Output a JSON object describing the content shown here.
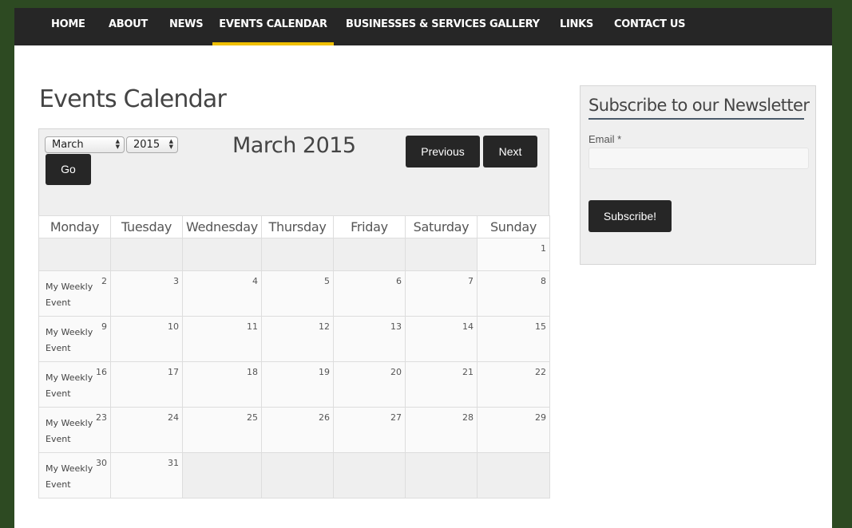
{
  "nav": {
    "items": [
      {
        "label": "HOME"
      },
      {
        "label": "ABOUT"
      },
      {
        "label": "NEWS"
      },
      {
        "label": "EVENTS CALENDAR",
        "active": true
      },
      {
        "label": "BUSINESSES & SERVICES"
      },
      {
        "label": "GALLERY"
      },
      {
        "label": "LINKS"
      },
      {
        "label": "CONTACT US"
      }
    ]
  },
  "page": {
    "title": "Events Calendar"
  },
  "calendar": {
    "month_select": "March",
    "year_select": "2015",
    "go_label": "Go",
    "title": "March 2015",
    "prev_label": "Previous",
    "next_label": "Next",
    "weekdays": [
      "Monday",
      "Tuesday",
      "Wednesday",
      "Thursday",
      "Friday",
      "Saturday",
      "Sunday"
    ],
    "weeks": [
      [
        null,
        null,
        null,
        null,
        null,
        null,
        {
          "day": "1"
        }
      ],
      [
        {
          "day": "2",
          "event": "My Weekly Event"
        },
        {
          "day": "3"
        },
        {
          "day": "4"
        },
        {
          "day": "5"
        },
        {
          "day": "6"
        },
        {
          "day": "7"
        },
        {
          "day": "8"
        }
      ],
      [
        {
          "day": "9",
          "event": "My Weekly Event"
        },
        {
          "day": "10"
        },
        {
          "day": "11"
        },
        {
          "day": "12"
        },
        {
          "day": "13"
        },
        {
          "day": "14"
        },
        {
          "day": "15"
        }
      ],
      [
        {
          "day": "16",
          "event": "My Weekly Event"
        },
        {
          "day": "17"
        },
        {
          "day": "18"
        },
        {
          "day": "19"
        },
        {
          "day": "20"
        },
        {
          "day": "21"
        },
        {
          "day": "22"
        }
      ],
      [
        {
          "day": "23",
          "event": "My Weekly Event"
        },
        {
          "day": "24"
        },
        {
          "day": "25"
        },
        {
          "day": "26"
        },
        {
          "day": "27"
        },
        {
          "day": "28"
        },
        {
          "day": "29"
        }
      ],
      [
        {
          "day": "30",
          "event": "My Weekly Event"
        },
        {
          "day": "31"
        },
        null,
        null,
        null,
        null,
        null
      ]
    ]
  },
  "sidebar": {
    "title": "Subscribe to our Newsletter",
    "email_label": "Email *",
    "email_value": "",
    "subscribe_label": "Subscribe!"
  },
  "colors": {
    "background": "#2d4a22",
    "nav": "#262626",
    "accent": "#f0c000"
  }
}
